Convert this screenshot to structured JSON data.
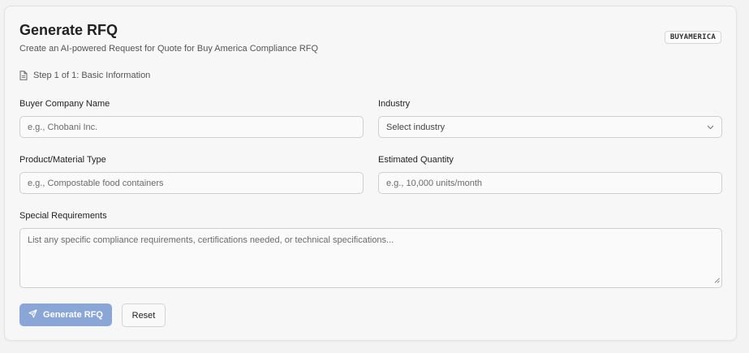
{
  "form": {
    "title": "Generate RFQ",
    "subtitle": "Create an AI-powered Request for Quote for Buy America Compliance RFQ",
    "badge": "BUYAMERICA",
    "step": "Step 1 of 1: Basic Information",
    "icons": {
      "step": "document-icon",
      "industry_select": "chevron-down-icon",
      "generate": "send-icon"
    }
  },
  "fields": {
    "buyer_company": {
      "label": "Buyer Company Name",
      "placeholder": "e.g., Chobani Inc."
    },
    "industry": {
      "label": "Industry",
      "placeholder": "Select industry"
    },
    "product_type": {
      "label": "Product/Material Type",
      "placeholder": "e.g., Compostable food containers"
    },
    "quantity": {
      "label": "Estimated Quantity",
      "placeholder": "e.g., 10,000 units/month"
    },
    "special_requirements": {
      "label": "Special Requirements",
      "placeholder": "List any specific compliance requirements, certifications needed, or technical specifications..."
    }
  },
  "actions": {
    "generate_label": "Generate RFQ",
    "reset_label": "Reset"
  },
  "colors": {
    "primary_button": "#8aa6d6",
    "card_background": "#f7f7f7"
  }
}
